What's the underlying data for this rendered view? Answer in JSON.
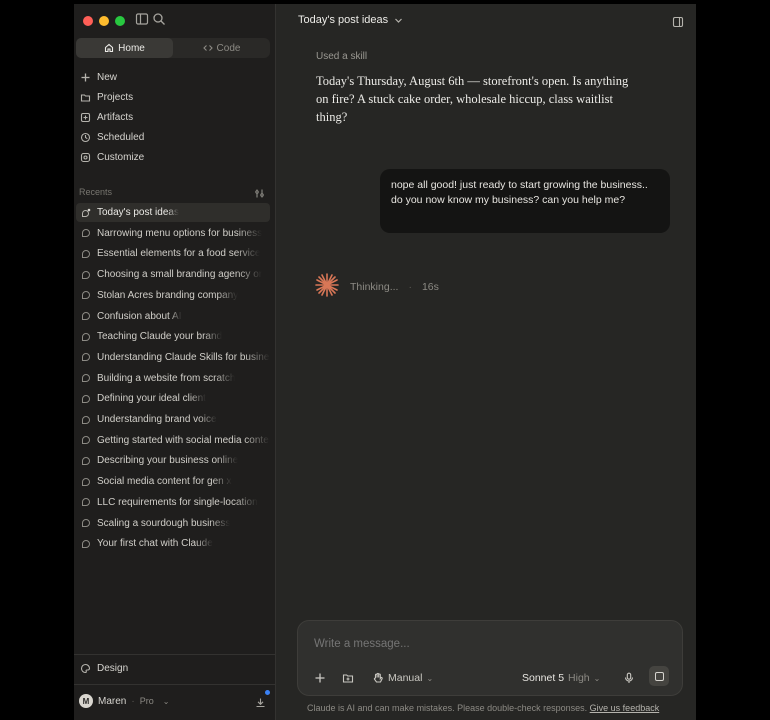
{
  "sidebar": {
    "modes": [
      {
        "label": "Home",
        "icon": "home-icon"
      },
      {
        "label": "Code",
        "icon": "code-icon"
      }
    ],
    "nav": [
      {
        "label": "New",
        "icon": "plus-icon"
      },
      {
        "label": "Projects",
        "icon": "folder-icon"
      },
      {
        "label": "Artifacts",
        "icon": "artifacts-icon"
      },
      {
        "label": "Scheduled",
        "icon": "clock-icon"
      },
      {
        "label": "Customize",
        "icon": "customize-icon"
      }
    ],
    "recents_label": "Recents",
    "recents": [
      "Today's post ideas",
      "Narrowing menu options for business",
      "Essential elements for a food service",
      "Choosing a small branding agency or",
      "Stolan Acres branding company",
      "Confusion about AI",
      "Teaching Claude your brand",
      "Understanding Claude Skills for business",
      "Building a website from scratch",
      "Defining your ideal client",
      "Understanding brand voice",
      "Getting started with social media content",
      "Describing your business online",
      "Social media content for gen x",
      "LLC requirements for single-location",
      "Scaling a sourdough business",
      "Your first chat with Claude"
    ],
    "design_label": "Design",
    "user": {
      "initial": "M",
      "name": "Maren",
      "plan": "Pro"
    }
  },
  "main": {
    "title": "Today's post ideas",
    "used_skill": "Used a skill",
    "assistant_message": "Today's Thursday, August 6th — storefront's open. Is anything on fire? A stuck cake order, wholesale hiccup, class waitlist thing?",
    "user_message": "nope all good! just ready to start growing the business.. do you now know my business? can you help me?",
    "thinking_label": "Thinking...",
    "thinking_time": "16s",
    "accent_color": "#d97757"
  },
  "composer": {
    "placeholder": "Write a message...",
    "mode_label": "Manual",
    "model": "Sonnet 5",
    "effort": "High"
  },
  "footer": {
    "disclaimer": "Claude is AI and can make mistakes. Please double-check responses.",
    "feedback_link": "Give us feedback"
  }
}
